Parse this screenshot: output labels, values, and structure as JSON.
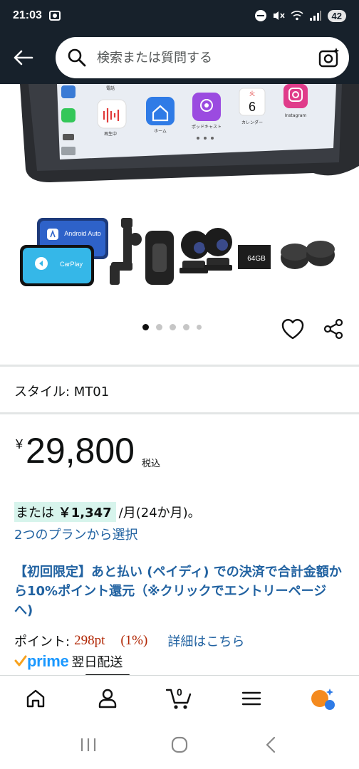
{
  "status_bar": {
    "time": "21:03",
    "battery": "42"
  },
  "search": {
    "placeholder": "検索または質問する"
  },
  "product_screen": {
    "app_labels": [
      "再生中",
      "ホーム",
      "ポッドキャスト",
      "カレンダー",
      "Instagram",
      "電話"
    ],
    "calendar_day": "6",
    "calendar_weekday": "火"
  },
  "accessories": {
    "android_auto_label": "Android Auto",
    "carplay_label": "CarPlay",
    "sd_card_label": "64GB"
  },
  "gallery": {
    "dot_count": 5,
    "active_index": 0
  },
  "style": {
    "label": "スタイル: MT01"
  },
  "price": {
    "symbol": "¥",
    "amount": "29,800",
    "tax_note": "税込"
  },
  "installment": {
    "prefix": "または ",
    "amount": "￥1,347",
    "suffix": "/月(24か月)。",
    "plan_link": "2つのプランから選択"
  },
  "promo": {
    "text": "【初回限定】あと払い (ペイディ) での決済で合計金額から10%ポイント還元（※クリックでエントリーページへ)"
  },
  "points": {
    "label": "ポイント:",
    "value": "298pt",
    "percent": "(1%)",
    "details_link": "詳細はこちら"
  },
  "prime": {
    "brand": "prime",
    "delivery": "翌日配送"
  },
  "bottom_nav": {
    "cart_count": "0"
  },
  "colors": {
    "header_bg": "#17212b",
    "link": "#2162a1",
    "price_red": "#b12704",
    "prime_blue": "#1a98ff",
    "highlight_bg": "#d7f4ec"
  }
}
